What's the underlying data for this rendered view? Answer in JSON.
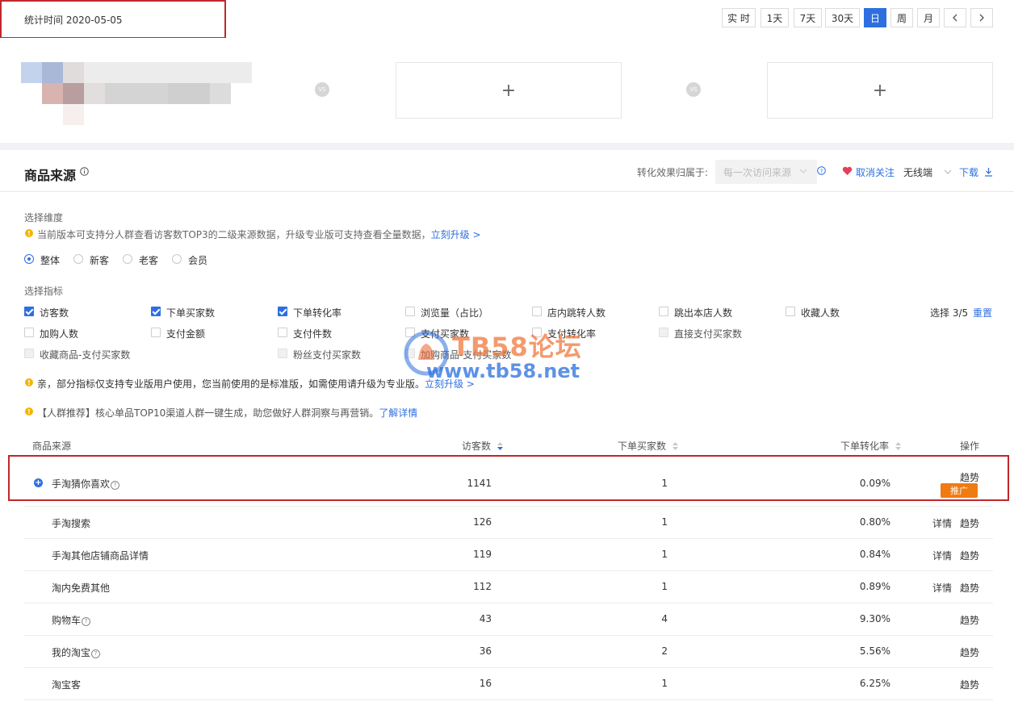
{
  "header": {
    "stat_time": "统计时间 2020-05-05",
    "time_buttons": [
      "实 时",
      "1天",
      "7天",
      "30天",
      "日",
      "周",
      "月"
    ],
    "active_button": "日"
  },
  "compare": {
    "vs_label": "VS",
    "add_symbol": "+"
  },
  "section": {
    "title": "商品来源",
    "attribution_label": "转化效果归属于:",
    "attribution_value": "每一次访问来源",
    "unfollow": "取消关注",
    "device": "无线端",
    "download": "下载"
  },
  "dimension": {
    "label": "选择维度",
    "notice": "当前版本可支持分人群查看访客数TOP3的二级来源数据，升级专业版可支持查看全量数据，",
    "upgrade_link": "立刻升级 >",
    "options": [
      "整体",
      "新客",
      "老客",
      "会员"
    ],
    "selected": "整体"
  },
  "metrics": {
    "label": "选择指标",
    "count": "选择 3/5",
    "reset": "重置",
    "items": [
      {
        "label": "访客数",
        "checked": true,
        "disabled": false
      },
      {
        "label": "下单买家数",
        "checked": true,
        "disabled": false
      },
      {
        "label": "下单转化率",
        "checked": true,
        "disabled": false
      },
      {
        "label": "浏览量（占比）",
        "checked": false,
        "disabled": false
      },
      {
        "label": "店内跳转人数",
        "checked": false,
        "disabled": false
      },
      {
        "label": "跳出本店人数",
        "checked": false,
        "disabled": false
      },
      {
        "label": "收藏人数",
        "checked": false,
        "disabled": false
      },
      {
        "label": "加购人数",
        "checked": false,
        "disabled": false
      },
      {
        "label": "支付金额",
        "checked": false,
        "disabled": false
      },
      {
        "label": "支付件数",
        "checked": false,
        "disabled": false
      },
      {
        "label": "支付买家数",
        "checked": false,
        "disabled": false
      },
      {
        "label": "支付转化率",
        "checked": false,
        "disabled": false
      },
      {
        "label": "直接支付买家数",
        "checked": false,
        "disabled": true
      },
      {
        "label": "收藏商品-支付买家数",
        "checked": false,
        "disabled": true
      },
      {
        "label": "粉丝支付买家数",
        "checked": false,
        "disabled": true
      },
      {
        "label": "加购商品-支付买家数",
        "checked": false,
        "disabled": true
      }
    ],
    "notice": "亲，部分指标仅支持专业版用户使用，您当前使用的是标准版，如需使用请升级为专业版。",
    "notice_link": "立刻升级 >",
    "recommend": "【人群推荐】核心单品TOP10渠道人群一键生成，助您做好人群洞察与再营销。",
    "recommend_link": "了解详情"
  },
  "table": {
    "headers": [
      "商品来源",
      "访客数",
      "下单买家数",
      "下单转化率",
      "操作"
    ],
    "rows": [
      {
        "source": "手淘猜你喜欢",
        "help": true,
        "visitors": "1141",
        "buyers": "1",
        "rate": "0.09%",
        "actions": [
          "趋势"
        ],
        "promo": "推广",
        "expand": true
      },
      {
        "source": "手淘搜索",
        "help": false,
        "visitors": "126",
        "buyers": "1",
        "rate": "0.80%",
        "actions": [
          "详情",
          "趋势"
        ]
      },
      {
        "source": "手淘其他店铺商品详情",
        "help": false,
        "visitors": "119",
        "buyers": "1",
        "rate": "0.84%",
        "actions": [
          "详情",
          "趋势"
        ]
      },
      {
        "source": "淘内免费其他",
        "help": false,
        "visitors": "112",
        "buyers": "1",
        "rate": "0.89%",
        "actions": [
          "详情",
          "趋势"
        ]
      },
      {
        "source": "购物车",
        "help": true,
        "visitors": "43",
        "buyers": "4",
        "rate": "9.30%",
        "actions": [
          "趋势"
        ]
      },
      {
        "source": "我的淘宝",
        "help": true,
        "visitors": "36",
        "buyers": "2",
        "rate": "5.56%",
        "actions": [
          "趋势"
        ]
      },
      {
        "source": "淘宝客",
        "help": false,
        "visitors": "16",
        "buyers": "1",
        "rate": "6.25%",
        "actions": [
          "趋势"
        ]
      }
    ]
  },
  "watermark": {
    "title": "TB58论坛",
    "url": "www.tb58.net"
  },
  "colors": {
    "accent": "#2d6fe0",
    "highlight": "#c0282b",
    "promo": "#f07b12"
  }
}
